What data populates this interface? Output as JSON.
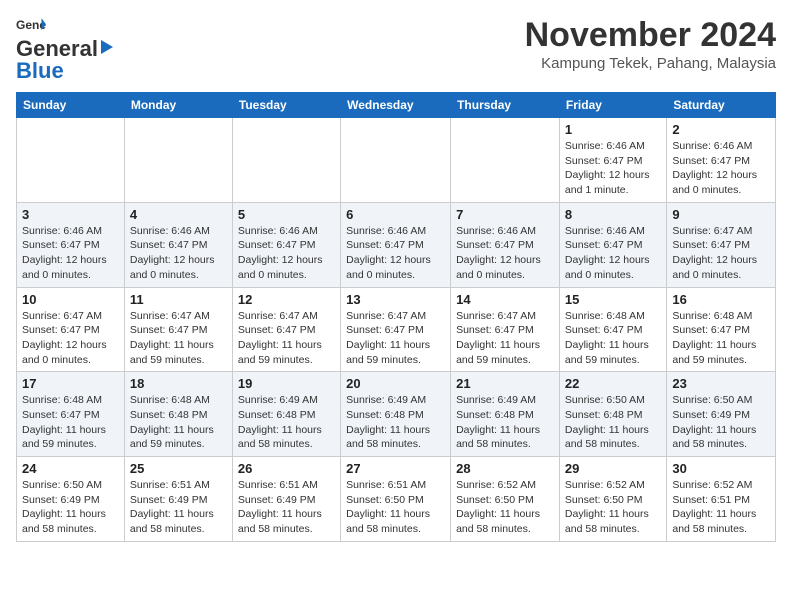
{
  "header": {
    "logo_line1": "General",
    "logo_line2": "Blue",
    "month_title": "November 2024",
    "location": "Kampung Tekek, Pahang, Malaysia"
  },
  "columns": [
    "Sunday",
    "Monday",
    "Tuesday",
    "Wednesday",
    "Thursday",
    "Friday",
    "Saturday"
  ],
  "weeks": [
    [
      {
        "day": "",
        "info": ""
      },
      {
        "day": "",
        "info": ""
      },
      {
        "day": "",
        "info": ""
      },
      {
        "day": "",
        "info": ""
      },
      {
        "day": "",
        "info": ""
      },
      {
        "day": "1",
        "info": "Sunrise: 6:46 AM\nSunset: 6:47 PM\nDaylight: 12 hours and 1 minute."
      },
      {
        "day": "2",
        "info": "Sunrise: 6:46 AM\nSunset: 6:47 PM\nDaylight: 12 hours and 0 minutes."
      }
    ],
    [
      {
        "day": "3",
        "info": "Sunrise: 6:46 AM\nSunset: 6:47 PM\nDaylight: 12 hours and 0 minutes."
      },
      {
        "day": "4",
        "info": "Sunrise: 6:46 AM\nSunset: 6:47 PM\nDaylight: 12 hours and 0 minutes."
      },
      {
        "day": "5",
        "info": "Sunrise: 6:46 AM\nSunset: 6:47 PM\nDaylight: 12 hours and 0 minutes."
      },
      {
        "day": "6",
        "info": "Sunrise: 6:46 AM\nSunset: 6:47 PM\nDaylight: 12 hours and 0 minutes."
      },
      {
        "day": "7",
        "info": "Sunrise: 6:46 AM\nSunset: 6:47 PM\nDaylight: 12 hours and 0 minutes."
      },
      {
        "day": "8",
        "info": "Sunrise: 6:46 AM\nSunset: 6:47 PM\nDaylight: 12 hours and 0 minutes."
      },
      {
        "day": "9",
        "info": "Sunrise: 6:47 AM\nSunset: 6:47 PM\nDaylight: 12 hours and 0 minutes."
      }
    ],
    [
      {
        "day": "10",
        "info": "Sunrise: 6:47 AM\nSunset: 6:47 PM\nDaylight: 12 hours and 0 minutes."
      },
      {
        "day": "11",
        "info": "Sunrise: 6:47 AM\nSunset: 6:47 PM\nDaylight: 11 hours and 59 minutes."
      },
      {
        "day": "12",
        "info": "Sunrise: 6:47 AM\nSunset: 6:47 PM\nDaylight: 11 hours and 59 minutes."
      },
      {
        "day": "13",
        "info": "Sunrise: 6:47 AM\nSunset: 6:47 PM\nDaylight: 11 hours and 59 minutes."
      },
      {
        "day": "14",
        "info": "Sunrise: 6:47 AM\nSunset: 6:47 PM\nDaylight: 11 hours and 59 minutes."
      },
      {
        "day": "15",
        "info": "Sunrise: 6:48 AM\nSunset: 6:47 PM\nDaylight: 11 hours and 59 minutes."
      },
      {
        "day": "16",
        "info": "Sunrise: 6:48 AM\nSunset: 6:47 PM\nDaylight: 11 hours and 59 minutes."
      }
    ],
    [
      {
        "day": "17",
        "info": "Sunrise: 6:48 AM\nSunset: 6:47 PM\nDaylight: 11 hours and 59 minutes."
      },
      {
        "day": "18",
        "info": "Sunrise: 6:48 AM\nSunset: 6:48 PM\nDaylight: 11 hours and 59 minutes."
      },
      {
        "day": "19",
        "info": "Sunrise: 6:49 AM\nSunset: 6:48 PM\nDaylight: 11 hours and 58 minutes."
      },
      {
        "day": "20",
        "info": "Sunrise: 6:49 AM\nSunset: 6:48 PM\nDaylight: 11 hours and 58 minutes."
      },
      {
        "day": "21",
        "info": "Sunrise: 6:49 AM\nSunset: 6:48 PM\nDaylight: 11 hours and 58 minutes."
      },
      {
        "day": "22",
        "info": "Sunrise: 6:50 AM\nSunset: 6:48 PM\nDaylight: 11 hours and 58 minutes."
      },
      {
        "day": "23",
        "info": "Sunrise: 6:50 AM\nSunset: 6:49 PM\nDaylight: 11 hours and 58 minutes."
      }
    ],
    [
      {
        "day": "24",
        "info": "Sunrise: 6:50 AM\nSunset: 6:49 PM\nDaylight: 11 hours and 58 minutes."
      },
      {
        "day": "25",
        "info": "Sunrise: 6:51 AM\nSunset: 6:49 PM\nDaylight: 11 hours and 58 minutes."
      },
      {
        "day": "26",
        "info": "Sunrise: 6:51 AM\nSunset: 6:49 PM\nDaylight: 11 hours and 58 minutes."
      },
      {
        "day": "27",
        "info": "Sunrise: 6:51 AM\nSunset: 6:50 PM\nDaylight: 11 hours and 58 minutes."
      },
      {
        "day": "28",
        "info": "Sunrise: 6:52 AM\nSunset: 6:50 PM\nDaylight: 11 hours and 58 minutes."
      },
      {
        "day": "29",
        "info": "Sunrise: 6:52 AM\nSunset: 6:50 PM\nDaylight: 11 hours and 58 minutes."
      },
      {
        "day": "30",
        "info": "Sunrise: 6:52 AM\nSunset: 6:51 PM\nDaylight: 11 hours and 58 minutes."
      }
    ]
  ]
}
